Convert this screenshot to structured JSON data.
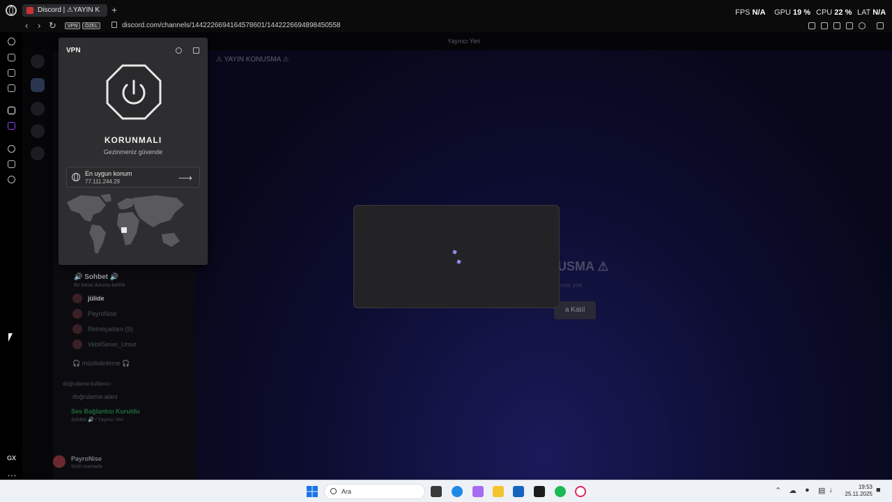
{
  "browser": {
    "tab_title": "Discord | ⚠YAYIN K",
    "new_tab": "+",
    "url": "discord.com/channels/1442226694164578601/1442226694898450558",
    "badge_vpn": "VPN",
    "badge_private": "ÖZEL",
    "back": "‹",
    "forward": "›",
    "reload": "↻"
  },
  "perf": {
    "fps_label": "FPS",
    "fps_value": "N/A",
    "gpu_label": "GPU",
    "gpu_value": "19 %",
    "cpu_label": "CPU",
    "cpu_value": "22 %",
    "lat_label": "LAT",
    "lat_value": "N/A"
  },
  "opera_sidebar": {
    "gx_label": "GX",
    "more": "…"
  },
  "discord": {
    "top_title": "Yayıncı Yeri",
    "channel_header": "⚠ YAYIN KONUSMA ⚠",
    "voice_channel": "🔊 Sohbet 🔊",
    "channel_status": "Bir kanal durumu belirle",
    "users": [
      "jülide",
      "PayroNise",
      "Retreiçadam (9)",
      "VebilSever_Umut"
    ],
    "music_channel": "🎧 müzikdinleme 🎧",
    "verify_category": "doğrulama kullanıcı",
    "verify_channel": "doğrulama-alani",
    "voice_connected": "Ses Bağlantısı Kuruldu",
    "voice_location": "Sohbet 🔊 / Yayıncı Yeri",
    "user_name": "PayroNise",
    "user_status": "Sesli oramada",
    "welcome_title": "USMA ⚠",
    "welcome_sub": "imse yok",
    "join_label": "a Katıl"
  },
  "vpn": {
    "title": "VPN",
    "status": "KORUNMALI",
    "status_sub": "Gezinmeniz güvende",
    "location_name": "En uygun konum",
    "location_ip": "77.111.244.29",
    "arrow": "⟶"
  },
  "taskbar": {
    "search_label": "Ara",
    "time": "19:53",
    "date": "25.11.2025"
  },
  "colors": {
    "vpn_panel": "#2e2e30",
    "discord_bg": "#08081a",
    "loader_accent": "#8c8cf0",
    "taskbar": "#eef1f5"
  }
}
